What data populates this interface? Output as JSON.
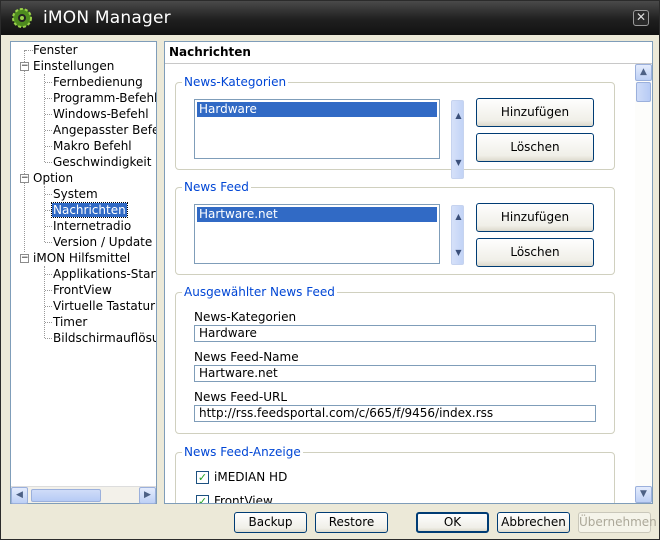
{
  "window": {
    "title": "iMON Manager",
    "close_glyph": "✕"
  },
  "tree": {
    "items": [
      {
        "label": "Fenster"
      },
      {
        "label": "Einstellungen",
        "expander": "−"
      },
      {
        "label": "Fernbedienung"
      },
      {
        "label": "Programm-Befehl"
      },
      {
        "label": "Windows-Befehl"
      },
      {
        "label": "Angepasster Befehl"
      },
      {
        "label": "Makro  Befehl"
      },
      {
        "label": "Geschwindigkeit"
      },
      {
        "label": "Option",
        "expander": "−"
      },
      {
        "label": "System"
      },
      {
        "label": "Nachrichten",
        "selected": true
      },
      {
        "label": "Internetradio"
      },
      {
        "label": "Version / Update"
      },
      {
        "label": "iMON Hilfsmittel",
        "expander": "−"
      },
      {
        "label": "Applikations-Starter"
      },
      {
        "label": "FrontView"
      },
      {
        "label": "Virtuelle Tastatur"
      },
      {
        "label": "Timer"
      },
      {
        "label": "Bildschirmauflösung"
      }
    ]
  },
  "panel": {
    "title": "Nachrichten",
    "categories": {
      "label": "News-Kategorien",
      "items": [
        "Hardware"
      ],
      "add_button": "Hinzufügen",
      "delete_button": "Löschen"
    },
    "feeds": {
      "label": "News Feed",
      "items": [
        "Hartware.net"
      ],
      "add_button": "Hinzufügen",
      "delete_button": "Löschen"
    },
    "selected_feed": {
      "label": "Ausgewählter News Feed",
      "category_label": "News-Kategorien",
      "category_value": "Hardware",
      "name_label": "News Feed-Name",
      "name_value": "Hartware.net",
      "url_label": "News Feed-URL",
      "url_value": "http://rss.feedsportal.com/c/665/f/9456/index.rss"
    },
    "display": {
      "label": "News Feed-Anzeige",
      "options": [
        {
          "label": "iMEDIAN HD",
          "checked": true
        },
        {
          "label": "FrontView",
          "checked": true
        }
      ]
    }
  },
  "footer": {
    "backup": "Backup",
    "restore": "Restore",
    "ok": "OK",
    "cancel": "Abbrechen",
    "apply": "Übernehmen"
  },
  "colors": {
    "selection": "#316ac5",
    "group_label": "#0046d5",
    "titlebar": "#1f1f1f"
  }
}
